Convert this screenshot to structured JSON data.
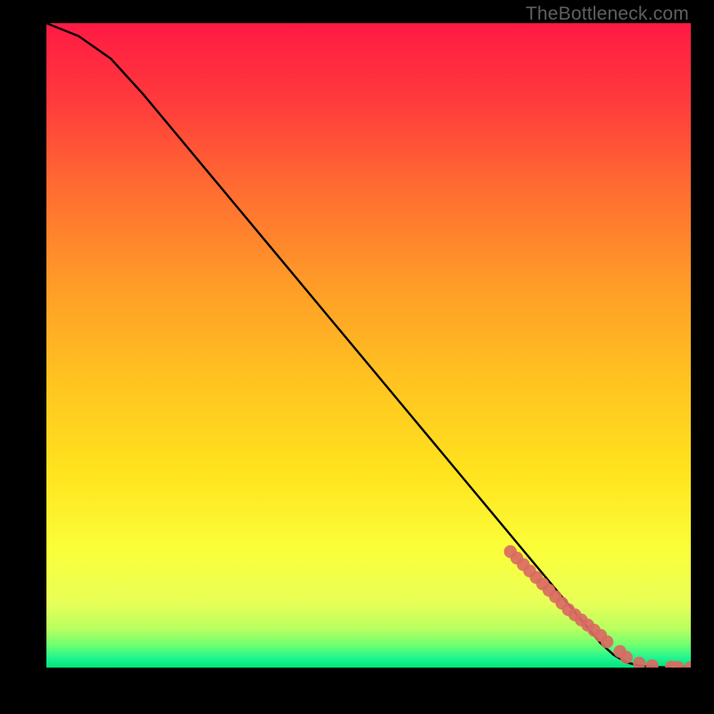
{
  "watermark": "TheBottleneck.com",
  "colors": {
    "bg": "#000000",
    "gradient_top": "#ff1a44",
    "gradient_mid_upper": "#ff7b2e",
    "gradient_mid": "#ffd21f",
    "gradient_mid_lower": "#faff3a",
    "gradient_green_mid": "#7dff5a",
    "gradient_bottom": "#00e37a",
    "curve": "#000000",
    "marker": "#d96a63"
  },
  "chart_data": {
    "type": "line",
    "x": [
      0,
      5,
      10,
      15,
      20,
      25,
      30,
      35,
      40,
      45,
      50,
      55,
      60,
      65,
      70,
      72,
      74,
      76,
      78,
      80,
      82,
      84,
      86,
      88,
      90,
      92,
      94,
      96,
      98,
      100
    ],
    "y": [
      100,
      98,
      94.5,
      89,
      83,
      77,
      71,
      65,
      59,
      53,
      47,
      41,
      35,
      29,
      23,
      20.6,
      18.2,
      15.8,
      13.4,
      11,
      8.6,
      6.2,
      3.8,
      2,
      0.8,
      0.3,
      0.1,
      0.05,
      0.02,
      0
    ],
    "xlim": [
      0,
      100
    ],
    "ylim": [
      0,
      100
    ],
    "xlabel": "",
    "ylabel": "",
    "title": "",
    "markers": {
      "note": "highlighted points overlaid on the curve",
      "x": [
        72,
        73,
        74,
        75,
        76,
        77,
        78,
        79,
        80,
        81,
        82,
        83,
        84,
        85,
        86,
        87,
        89,
        90,
        92,
        94,
        97,
        98,
        100
      ],
      "y": [
        18,
        17,
        16,
        15,
        14,
        13,
        12,
        11,
        10,
        9,
        8.2,
        7.4,
        6.6,
        5.8,
        5,
        4,
        2.5,
        1.6,
        0.7,
        0.3,
        0.1,
        0.05,
        0
      ]
    }
  }
}
